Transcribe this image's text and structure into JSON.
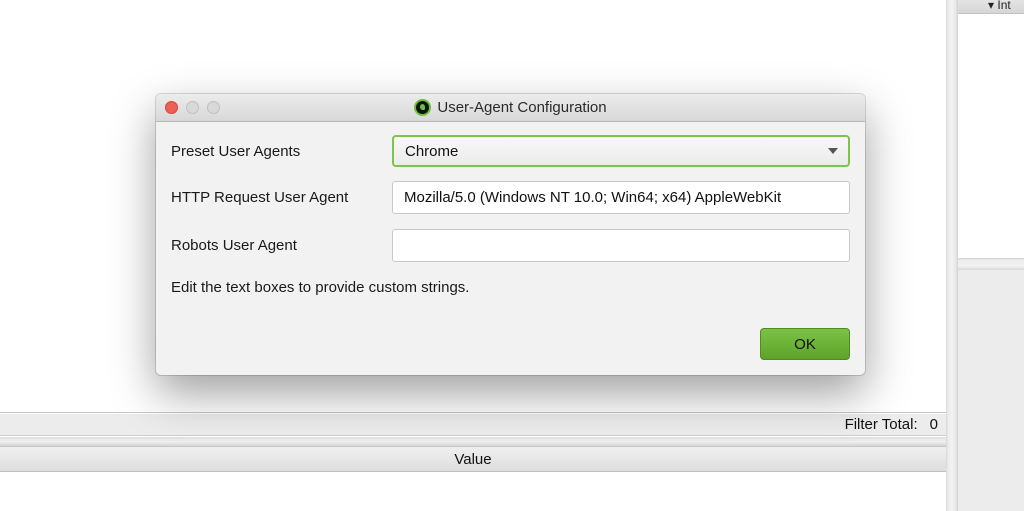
{
  "background": {
    "right_panel_header_label": "Int",
    "filter_total_label": "Filter Total:",
    "filter_total_value": "0",
    "table_column_header": "Value"
  },
  "dialog": {
    "title": "User-Agent Configuration",
    "app_icon": "green-bug-icon",
    "window_controls": [
      "close",
      "minimize",
      "maximize"
    ],
    "fields": {
      "preset": {
        "label": "Preset User Agents",
        "selected": "Chrome"
      },
      "http_request": {
        "label": "HTTP Request User Agent",
        "value": "Mozilla/5.0 (Windows NT 10.0; Win64; x64) AppleWebKit"
      },
      "robots": {
        "label": "Robots User Agent",
        "value": ""
      }
    },
    "hint": "Edit the text boxes to provide custom strings.",
    "ok_label": "OK"
  },
  "colors": {
    "accent_green": "#6bbf3a",
    "close_red": "#ec5f57"
  }
}
